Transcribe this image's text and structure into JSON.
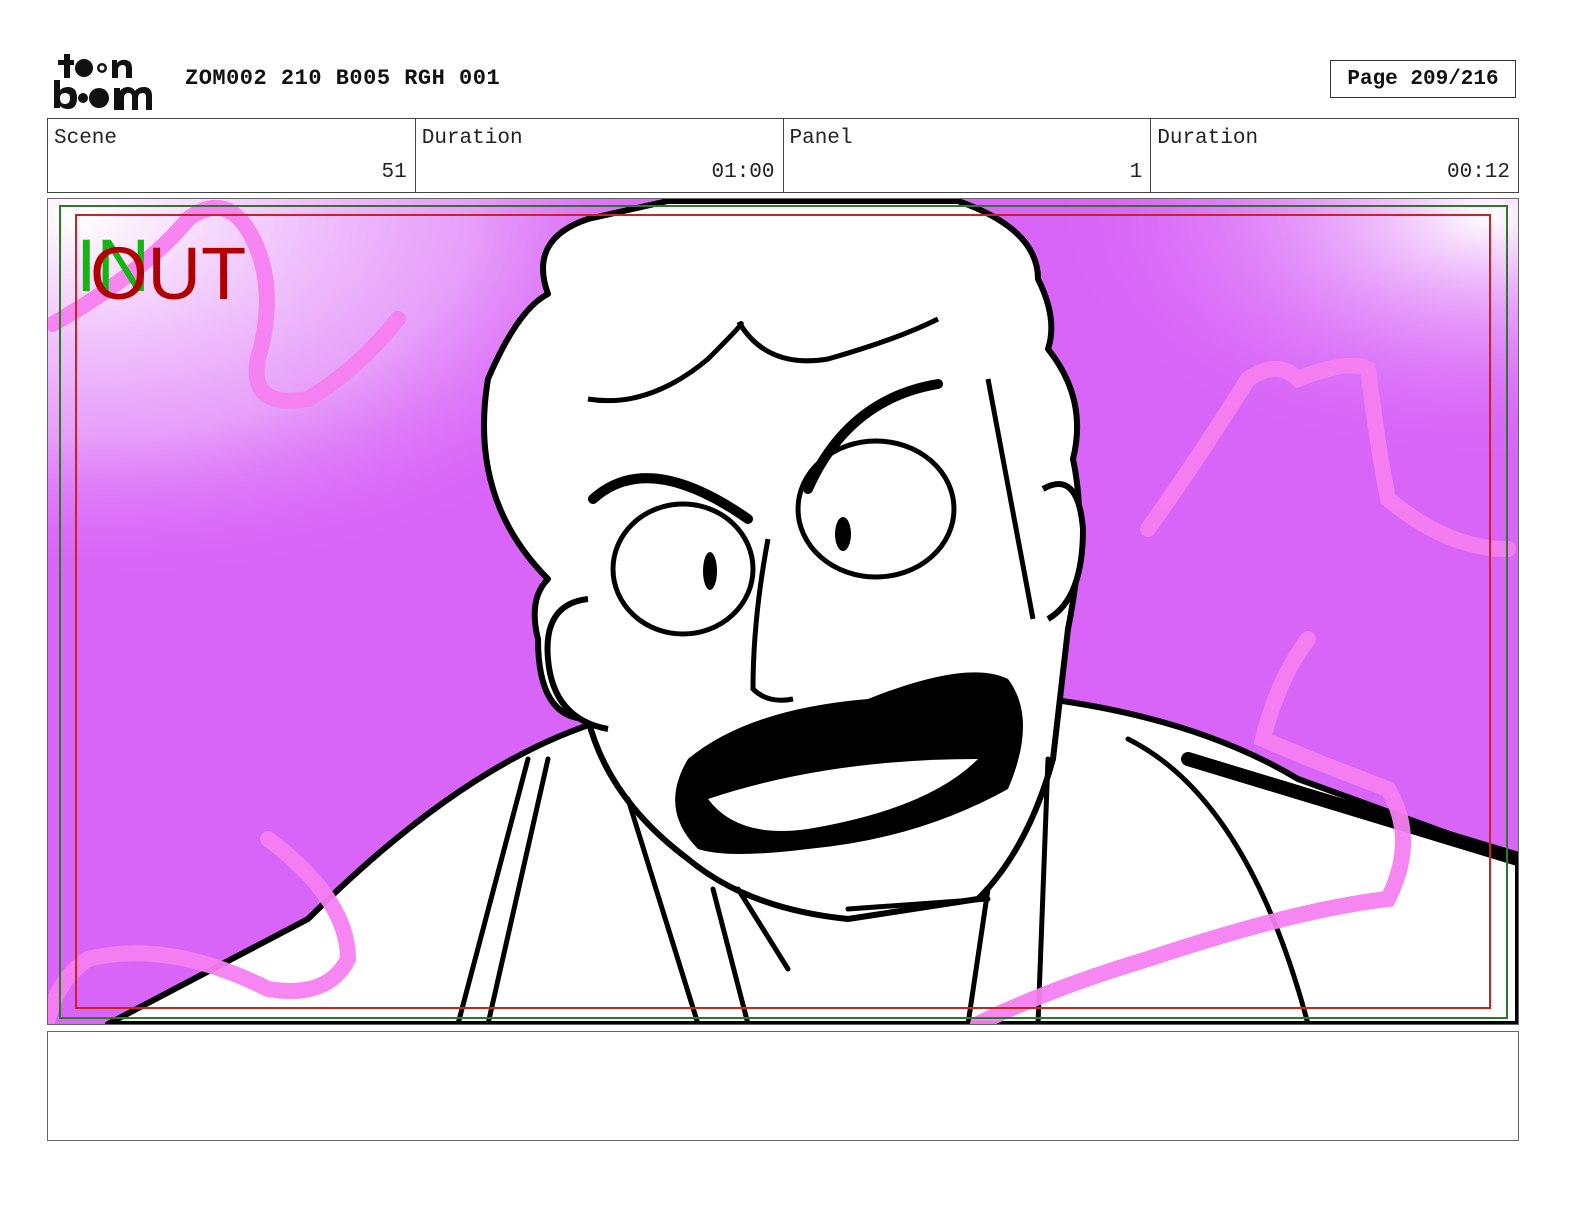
{
  "header": {
    "logo_text": "toon boom",
    "title": "ZOM002 210 B005 RGH 001",
    "page": "Page 209/216"
  },
  "info": {
    "scene_label": "Scene",
    "scene_value": "51",
    "scene_duration_label": "Duration",
    "scene_duration_value": "01:00",
    "panel_label": "Panel",
    "panel_value": "1",
    "panel_duration_label": "Duration",
    "panel_duration_value": "00:12"
  },
  "panel": {
    "in_marker": "IN",
    "out_marker": "OUT",
    "background_color": "#d865f7",
    "fx_stroke_color": "#f57ff0",
    "safe_area_color": "#cc2222",
    "frame_color": "#2a7a2a"
  },
  "notes": {
    "text": ""
  }
}
